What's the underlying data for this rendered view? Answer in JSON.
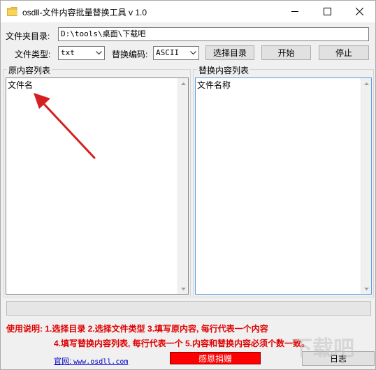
{
  "window": {
    "title": "osdll-文件内容批量替换工具 v 1.0"
  },
  "form": {
    "folder_label": "文件夹目录:",
    "folder_value": "D:\\tools\\桌面\\下载吧",
    "filetype_label": "文件类型:",
    "filetype_value": "txt",
    "encoding_label": "替换编码:",
    "encoding_value": "ASCII",
    "select_dir_button": "选择目录",
    "start_button": "开始",
    "stop_button": "停止"
  },
  "left_group": {
    "legend": "原内容列表",
    "item": "文件名"
  },
  "right_group": {
    "legend": "替换内容列表",
    "item": "文件名称"
  },
  "instructions": {
    "line1": "使用说明: 1.选择目录   2.选择文件类型   3.填写原内容, 每行代表一个内容",
    "line2": "4.填写替换内容列表, 每行代表一个   5.内容和替换内容必须个数一致。"
  },
  "footer": {
    "site_label": "官网:",
    "site_url": "www.osdll.com",
    "donate_button": "感恩捐赠",
    "log_button": "日志"
  },
  "colors": {
    "instruction_red": "#e00000",
    "donate_red": "#ff0000",
    "link_blue": "#0000cc",
    "arrow_red": "#d42020"
  },
  "watermark": {
    "text": "下载吧"
  }
}
